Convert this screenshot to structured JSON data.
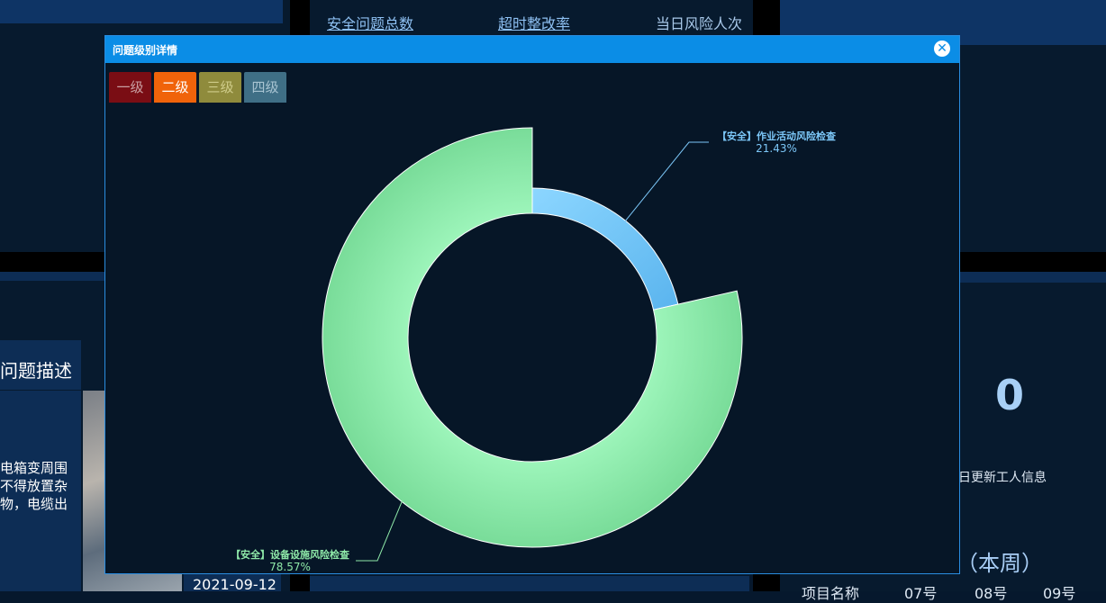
{
  "top_stats": {
    "total_issues": "安全问题总数",
    "overdue_rate": "超时整改率",
    "daily_risk": "当日风险人次"
  },
  "background": {
    "issue_desc_header": "问题描述",
    "issue_desc_text": "电箱变周围不得放置杂物，电缆出线转角井",
    "date": "2021-09-12",
    "big_number": "0",
    "worker_info": "当日更新工人信息",
    "week_label": "（本周）",
    "table_headers": [
      "项目名称",
      "07号",
      "08号",
      "09号"
    ]
  },
  "modal": {
    "title": "问题级别详情",
    "close_icon": "close-circle-icon",
    "levels": [
      {
        "label": "一级",
        "bg": "#7a0d14",
        "color": "#c9a0a3"
      },
      {
        "label": "二级",
        "bg": "#f0630a",
        "color": "#ffffff"
      },
      {
        "label": "三级",
        "bg": "#8f8b3c",
        "color": "#cfcc8a"
      },
      {
        "label": "四级",
        "bg": "#3f6f86",
        "color": "#a8c4d2"
      }
    ]
  },
  "chart_data": {
    "type": "pie",
    "donut": true,
    "title": "",
    "slices": [
      {
        "name": "【安全】作业活动风险检查",
        "value": 21.43,
        "label": "21.43%",
        "color": "#7cc7f8"
      },
      {
        "name": "【安全】设备设施风险检查",
        "value": 78.57,
        "label": "78.57%",
        "color": "#8ee8a8"
      }
    ],
    "legend": "none"
  }
}
